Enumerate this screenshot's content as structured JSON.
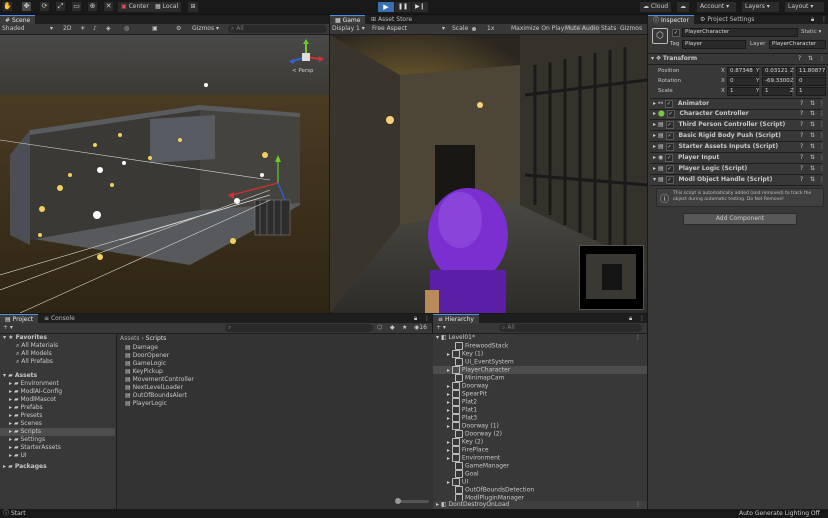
{
  "toolbar": {
    "tools": [
      "hand-tool",
      "move-tool",
      "rotate-tool",
      "scale-tool",
      "rect-tool",
      "transform-tool",
      "custom-tool"
    ],
    "pivot_mode": "Center",
    "pivot_space": "Local",
    "cloud_label": "Cloud",
    "account_label": "Account",
    "layers_label": "Layers",
    "layout_label": "Layout"
  },
  "scene_panel": {
    "tab": "Scene",
    "shading": "Shaded",
    "mode_2d": "2D",
    "gizmos": "Gizmos",
    "search_placeholder": "All",
    "persp_label": "< Persp"
  },
  "game_panel": {
    "tabs": [
      "Game",
      "Asset Store"
    ],
    "display": "Display 1",
    "aspect": "Free Aspect",
    "scale_label": "Scale",
    "scale_value": "1x",
    "options": [
      "Maximize On Play",
      "Mute Audio",
      "Stats",
      "Gizmos"
    ]
  },
  "inspector": {
    "tabs": [
      "Inspector",
      "Project Settings"
    ],
    "object_name": "PlayerCharacter",
    "static_label": "Static",
    "tag_label": "Tag",
    "tag_value": "Player",
    "layer_label": "Layer",
    "layer_value": "PlayerCharacter",
    "transform": {
      "title": "Transform",
      "position_label": "Position",
      "rotation_label": "Rotation",
      "scale_label": "Scale",
      "position": {
        "x": "0.87348",
        "y": "0.03121",
        "z": "11.80877"
      },
      "rotation": {
        "x": "0",
        "y": "-69.3300",
        "z": "0"
      },
      "scale": {
        "x": "1",
        "y": "1",
        "z": "1"
      }
    },
    "components": [
      "Animator",
      "Character Controller",
      "Third Person Controller (Script)",
      "Basic Rigid Body Push (Script)",
      "Starter Assets Inputs (Script)",
      "Player Input",
      "Player Logic (Script)",
      "Modl Object Handle (Script)"
    ],
    "info_text": "This script is automatically added (and removed) to track the object during automatic testing. Do Not Remove!",
    "add_component": "Add Component"
  },
  "project_panel": {
    "tabs": [
      "Project",
      "Console"
    ],
    "favorites_label": "Favorites",
    "favorites": [
      "All Materials",
      "All Models",
      "All Prefabs"
    ],
    "assets_label": "Assets",
    "asset_folders": [
      "Environment",
      "ModlAI-Config",
      "ModlMascot",
      "Prefabs",
      "Presets",
      "Scenes",
      "Scripts",
      "Settings",
      "StarterAssets",
      "UI"
    ],
    "packages_label": "Packages",
    "breadcrumb": [
      "Assets",
      "Scripts"
    ],
    "files": [
      "Damage",
      "DoorOpener",
      "GameLogic",
      "KeyPickup",
      "MovementController",
      "NextLevelLoader",
      "OutOfBoundsAlert",
      "PlayerLogic"
    ],
    "hidden_count": "16"
  },
  "hierarchy": {
    "tab": "Hierarchy",
    "search_placeholder": "All",
    "scene_name": "Level01*",
    "items": [
      "FirewoodStack",
      "Key (1)",
      "UI_EventSystem",
      "PlayerCharacter",
      "MinimapCam",
      "Doorway",
      "SpearPit",
      "Plat2",
      "Plat1",
      "Plat3",
      "Doorway (1)",
      "Doorway (2)",
      "Key (2)",
      "FirePlace",
      "Environment",
      "GameManager",
      "Goal",
      "UI",
      "OutOfBoundsDetection",
      "ModlPluginManager"
    ],
    "dont_destroy": "DontDestroyOnLoad"
  },
  "status_bar": {
    "start": "Start",
    "lighting": "Auto Generate Lighting Off"
  },
  "colors": {
    "accent": "#4a8fe0",
    "selection": "#2c5d87",
    "play_active": "#3a6fb0",
    "wall": "#5d6168",
    "character": "#7b2fd0"
  }
}
